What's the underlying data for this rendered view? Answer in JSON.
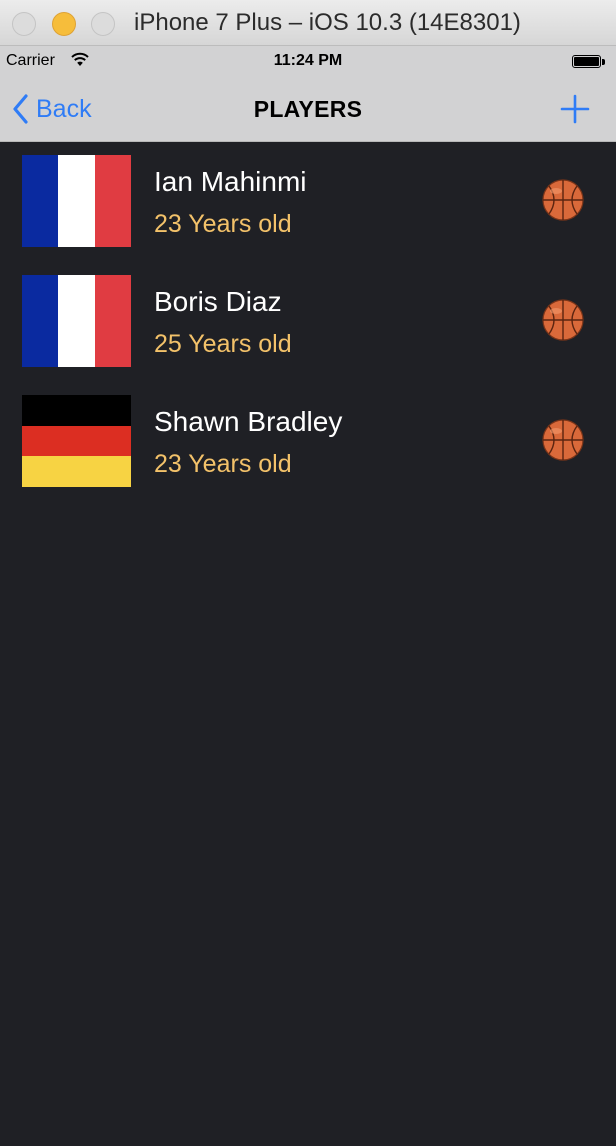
{
  "window": {
    "title": "iPhone 7 Plus – iOS 10.3 (14E8301)"
  },
  "status_bar": {
    "carrier": "Carrier",
    "time": "11:24 PM",
    "battery_level": 1.0
  },
  "nav": {
    "back_label": "Back",
    "title": "PLAYERS",
    "add_icon": "plus-icon",
    "tint_color": "#2f7cf6"
  },
  "colors": {
    "background": "#1f2025",
    "name": "#ffffff",
    "age": "#f3c26a"
  },
  "players": [
    {
      "name": "Ian Mahinmi",
      "age": "23 Years old",
      "flag": "france",
      "icon": "basketball-icon"
    },
    {
      "name": "Boris Diaz",
      "age": "25 Years old",
      "flag": "france",
      "icon": "basketball-icon"
    },
    {
      "name": "Shawn Bradley",
      "age": "23 Years old",
      "flag": "germany",
      "icon": "basketball-icon"
    }
  ],
  "flag_colors": {
    "france": [
      "#0a2aa0",
      "#ffffff",
      "#e03c42"
    ],
    "germany": [
      "#000000",
      "#dc2e22",
      "#f7d343"
    ]
  }
}
